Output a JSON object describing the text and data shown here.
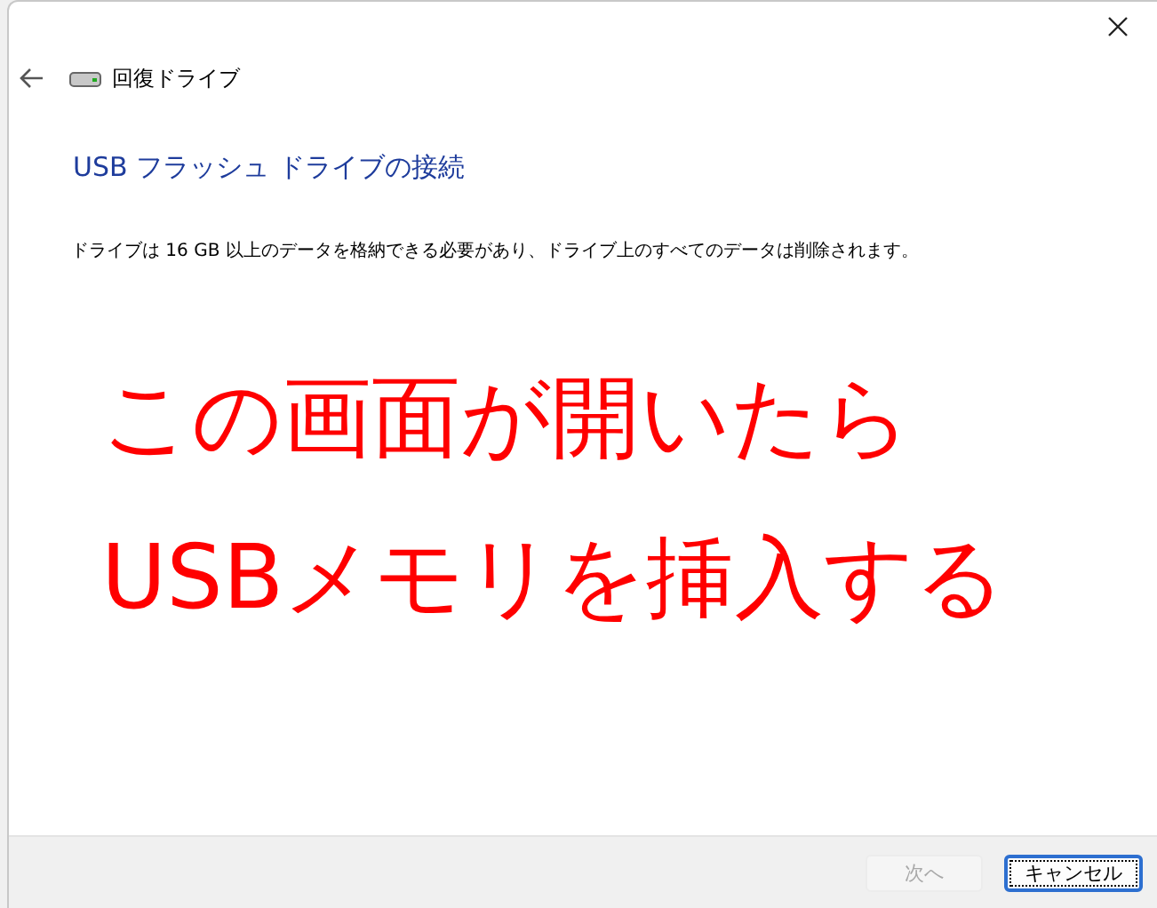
{
  "window": {
    "title": "回復ドライブ"
  },
  "heading": "USB フラッシュ ドライブの接続",
  "description": "ドライブは 16 GB 以上のデータを格納できる必要があり、ドライブ上のすべてのデータは削除されます。",
  "annotation": [
    "この画面が開いたら",
    "USBメモリを挿入する"
  ],
  "buttons": [
    {
      "label": "次へ",
      "disabled": true,
      "focused": false
    },
    {
      "label": "キャンセル",
      "disabled": false,
      "focused": true
    }
  ]
}
